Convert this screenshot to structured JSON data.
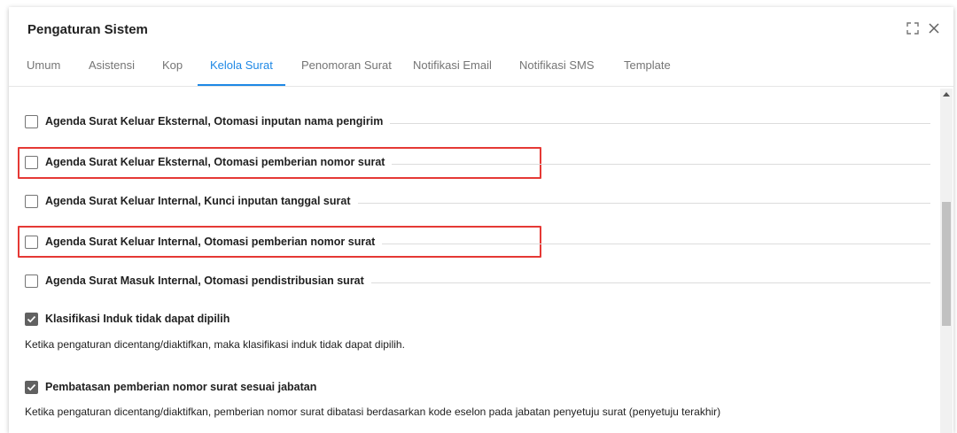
{
  "dialog": {
    "title": "Pengaturan Sistem",
    "icons": {
      "maximize": "maximize-icon",
      "close": "close-icon"
    }
  },
  "tabs": [
    {
      "label": "Umum",
      "active": false
    },
    {
      "label": "Asistensi",
      "active": false
    },
    {
      "label": "Kop",
      "active": false
    },
    {
      "label": "Kelola Surat",
      "active": true
    },
    {
      "label": "Penomoran Surat",
      "active": false
    },
    {
      "label": "Notifikasi Email",
      "active": false
    },
    {
      "label": "Notifikasi SMS",
      "active": false
    },
    {
      "label": "Template",
      "active": false
    }
  ],
  "settings": [
    {
      "label": "Agenda Surat Keluar Eksternal, Otomasi inputan nama pengirim",
      "checked": false
    },
    {
      "label": "Agenda Surat Keluar Eksternal, Otomasi pemberian nomor surat",
      "checked": false
    },
    {
      "label": "Agenda Surat Keluar Internal, Kunci inputan tanggal surat",
      "checked": false
    },
    {
      "label": "Agenda Surat Keluar Internal, Otomasi pemberian nomor surat",
      "checked": false
    },
    {
      "label": "Agenda Surat Masuk Internal, Otomasi pendistribusian surat",
      "checked": false
    },
    {
      "label": "Klasifikasi Induk tidak dapat dipilih",
      "checked": true,
      "description": "Ketika pengaturan dicentang/diaktifkan, maka klasifikasi induk tidak dapat dipilih."
    },
    {
      "label": "Pembatasan pemberian nomor surat sesuai jabatan",
      "checked": true,
      "description": "Ketika pengaturan dicentang/diaktifkan, pemberian nomor surat dibatasi berdasarkan kode eselon pada jabatan penyetuju surat (penyetuju terakhir)"
    }
  ],
  "colors": {
    "accent": "#1e88e5",
    "highlight": "#e53935",
    "checkbox_checked": "#616161"
  }
}
